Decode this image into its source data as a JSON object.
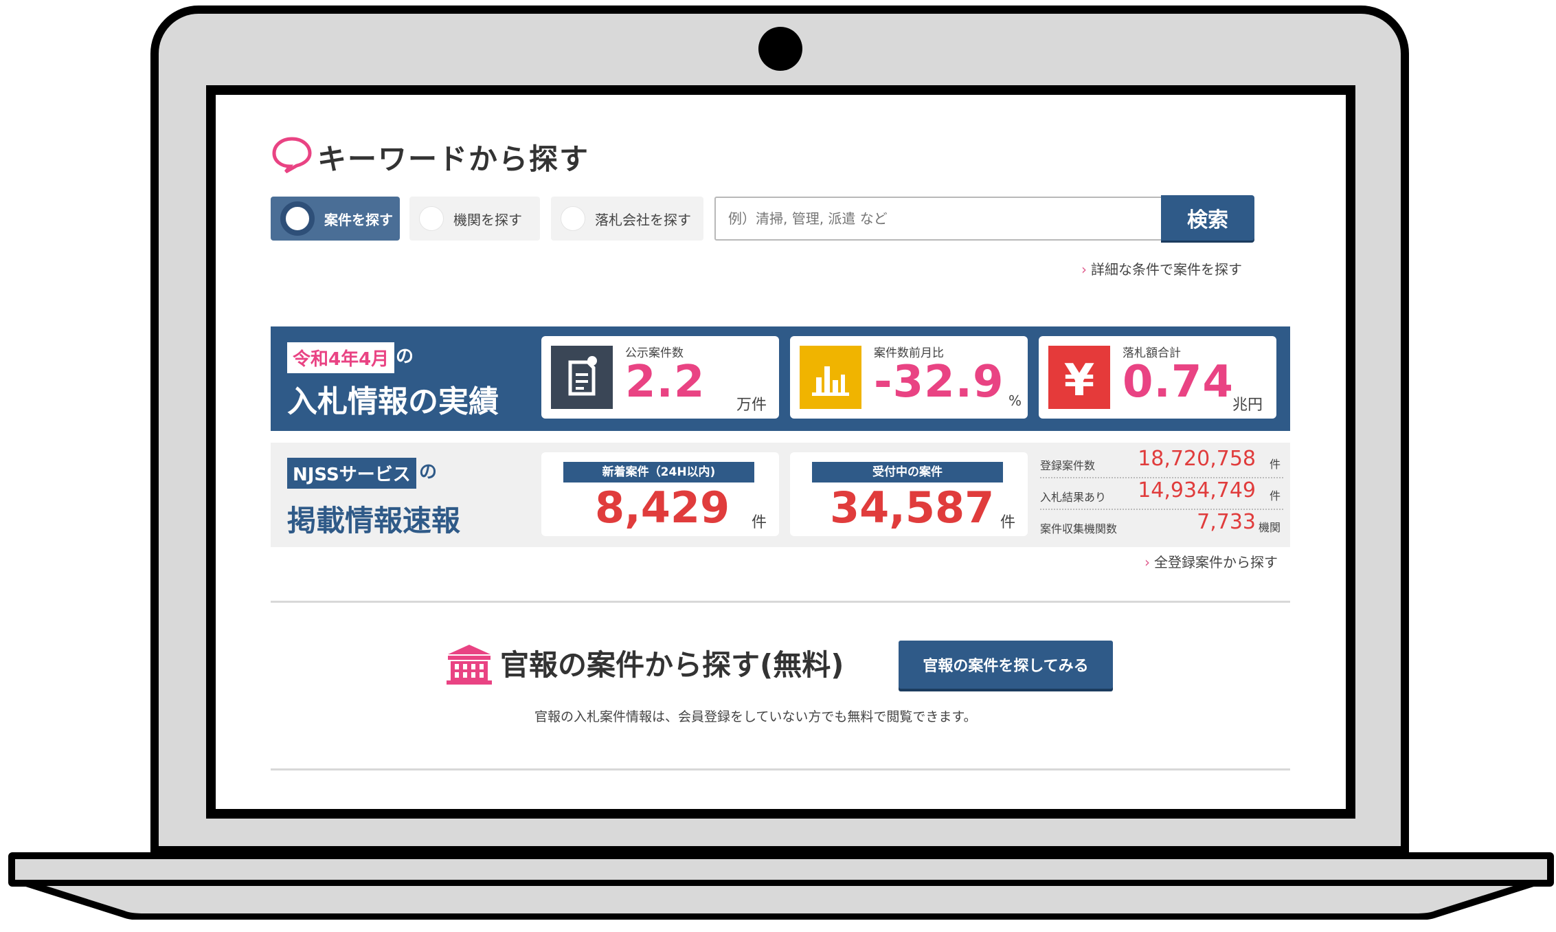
{
  "keyword_section": {
    "title": "キーワードから探す",
    "tabs": [
      {
        "label": "案件を探す",
        "selected": true
      },
      {
        "label": "機関を探す",
        "selected": false
      },
      {
        "label": "落札会社を探す",
        "selected": false
      }
    ],
    "search_placeholder": "例）清掃, 管理, 派遣 など",
    "search_button": "検索",
    "advanced_link": "詳細な条件で案件を探す"
  },
  "results": {
    "period_tag": "令和4年4月",
    "period_suffix": "の",
    "title": "入札情報の実績",
    "cards": [
      {
        "label": "公示案件数",
        "value": "2.2",
        "unit": "万件",
        "icon": "document-edit-icon",
        "icon_color": "#3a4656"
      },
      {
        "label": "案件数前月比",
        "value": "-32.9",
        "unit": "%",
        "icon": "bar-chart-icon",
        "icon_color": "#f0b400"
      },
      {
        "label": "落札額合計",
        "value": "0.74",
        "unit": "兆円",
        "icon": "yen-icon",
        "icon_color": "#e53a3a"
      }
    ]
  },
  "njss": {
    "tag": "NJSSサービス",
    "tag_suffix": "の",
    "title": "掲載情報速報",
    "new_cards": [
      {
        "header": "新着案件（24H以内)",
        "value": "8,429",
        "unit": "件"
      },
      {
        "header": "受付中の案件",
        "value": "34,587",
        "unit": "件"
      }
    ],
    "stats": [
      {
        "label": "登録案件数",
        "value": "18,720,758",
        "unit": "件"
      },
      {
        "label": "入札結果あり",
        "value": "14,934,749",
        "unit": "件"
      },
      {
        "label": "案件収集機関数",
        "value": "7,733",
        "unit": "機関"
      }
    ],
    "all_link": "全登録案件から探す"
  },
  "gazette": {
    "title": "官報の案件から探す(無料)",
    "button": "官報の案件を探してみる",
    "description": "官報の入札案件情報は、会員登録をしていない方でも無料で閲覧できます。"
  },
  "colors": {
    "navy": "#2f5a88",
    "pink": "#e94383",
    "red": "#e03c3c"
  }
}
